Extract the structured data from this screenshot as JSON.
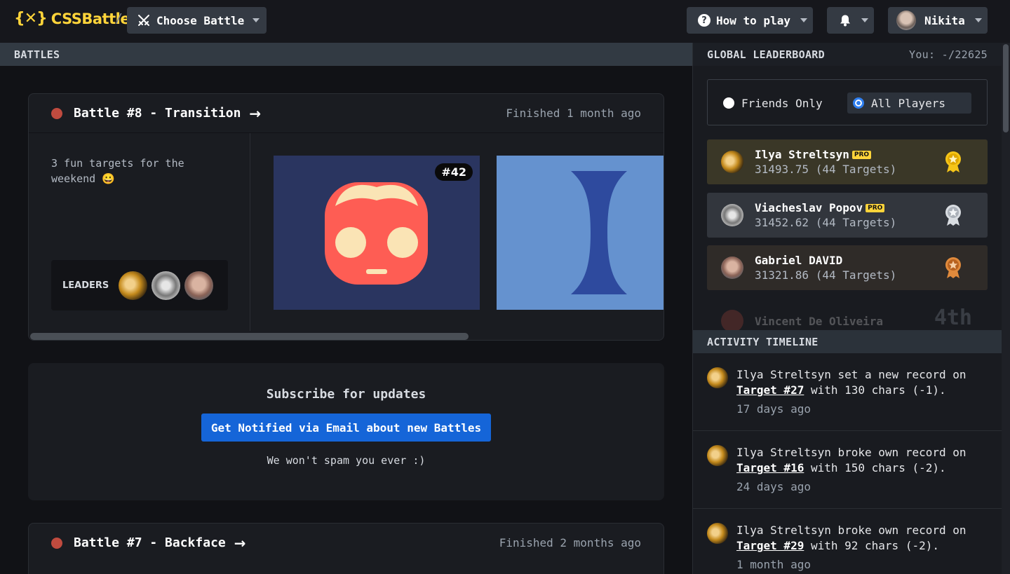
{
  "app": {
    "logo_mark": "{✕}",
    "logo_text": "CSSBattle",
    "crumb_separator": "/"
  },
  "topbar": {
    "choose_battle": "Choose Battle",
    "how_to_play": "How to play",
    "user_name": "Nikita"
  },
  "battles": {
    "header": "BATTLES",
    "cards": [
      {
        "title": "Battle #8 - Transition",
        "status": "Finished 1 month ago",
        "description": "3 fun targets for the weekend 😀",
        "leaders_label": "LEADERS",
        "targets": [
          {
            "badge": "#42",
            "bg": "#2a3560"
          },
          {
            "badge": "",
            "bg": "#6592cf"
          }
        ]
      },
      {
        "title": "Battle #7 - Backface",
        "status": "Finished 2 months ago"
      }
    ],
    "subscribe": {
      "title": "Subscribe for updates",
      "button": "Get Notified via Email about new Battles",
      "note": "We won't spam you ever :)"
    }
  },
  "leaderboard": {
    "header": "GLOBAL LEADERBOARD",
    "you": "You: -/22625",
    "filters": [
      {
        "label": "Friends Only",
        "selected": false
      },
      {
        "label": "All Players",
        "selected": true
      }
    ],
    "rows": [
      {
        "name": "Ilya Streltsyn",
        "pro": "PRO",
        "score": "31493.75 (44 Targets)",
        "medal": "gold"
      },
      {
        "name": "Viacheslav Popov",
        "pro": "PRO",
        "score": "31452.62 (44 Targets)",
        "medal": "silver"
      },
      {
        "name": "Gabriel DAVID",
        "pro": "",
        "score": "31321.86 (44 Targets)",
        "medal": "bronze"
      },
      {
        "name": "Vincent De Oliveira",
        "pro": "",
        "score": "",
        "rank": "4th"
      }
    ]
  },
  "activity": {
    "header": "ACTIVITY TIMELINE",
    "items": [
      {
        "pre": "Ilya Streltsyn set a new record on ",
        "target": "Target #27",
        "post": " with 130 chars (-1).",
        "time": "17 days ago"
      },
      {
        "pre": "Ilya Streltsyn broke own record on ",
        "target": "Target #16",
        "post": " with 150 chars (-2).",
        "time": "24 days ago"
      },
      {
        "pre": "Ilya Streltsyn broke own record on ",
        "target": "Target #29",
        "post": " with 92 chars (-2).",
        "time": "1 month ago"
      }
    ]
  },
  "colors": {
    "accent": "#ffd43a",
    "primary_button": "#1565d8",
    "status_dot": "#c04b3f"
  }
}
